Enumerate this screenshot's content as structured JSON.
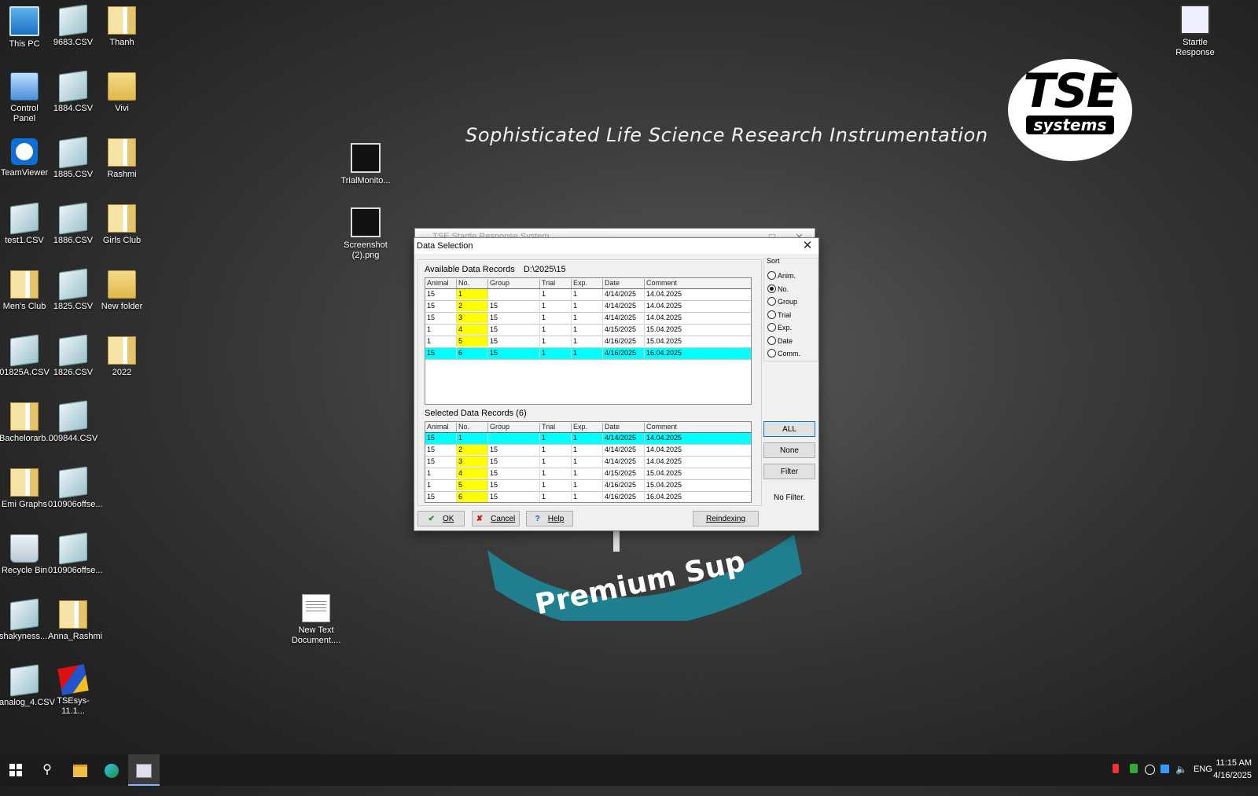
{
  "desktop": {
    "col1": [
      "This PC",
      "Control Panel",
      "TeamViewer",
      "test1.CSV",
      "Men's Club",
      "01825A.CSV",
      "Bachelorarb...",
      "Emi Graphs",
      "Recycle Bin",
      "shakyness....",
      "analog_4.CSV"
    ],
    "col2": [
      "9683.CSV",
      "1884.CSV",
      "1885.CSV",
      "1886.CSV",
      "1825.CSV",
      "1826.CSV",
      "009844.CSV",
      "010906offse...",
      "010906offse...",
      "Anna_Rashmi",
      "TSEsys-11.1..."
    ],
    "col3": [
      "Thanh",
      "Vivi",
      "Rashmi",
      "Girls Club",
      "New folder",
      "2022"
    ],
    "middle": [
      "TrialMonito...",
      "Screenshot (2).png",
      "New Text Document...."
    ],
    "topright": "Startle Response"
  },
  "wallpaper": {
    "slogan": "Sophisticated Life Science Research Instrumentation",
    "logo_big": "TSE",
    "logo_small": "systems",
    "premium": "Premium Sup"
  },
  "bg_window": {
    "title": "TSE Startle Response System"
  },
  "dialog": {
    "title": "Data Selection",
    "available_label": "Available Data Records",
    "available_path": "D:\\2025\\15",
    "selected_label": "Selected Data Records (6)",
    "columns": [
      "Animal",
      "No.",
      "Group",
      "Trial",
      "Exp.",
      "Date",
      "Comment"
    ],
    "available_rows": [
      [
        "15",
        "1",
        "",
        "1",
        "1",
        "4/14/2025",
        "14.04.2025"
      ],
      [
        "15",
        "2",
        "15",
        "1",
        "1",
        "4/14/2025",
        "14.04.2025"
      ],
      [
        "15",
        "3",
        "15",
        "1",
        "1",
        "4/14/2025",
        "14.04.2025"
      ],
      [
        "1",
        "4",
        "15",
        "1",
        "1",
        "4/15/2025",
        "15.04.2025"
      ],
      [
        "1",
        "5",
        "15",
        "1",
        "1",
        "4/16/2025",
        "15.04.2025"
      ],
      [
        "15",
        "6",
        "15",
        "1",
        "1",
        "4/16/2025",
        "16.04.2025"
      ]
    ],
    "selected_rows": [
      [
        "15",
        "1",
        "",
        "1",
        "1",
        "4/14/2025",
        "14.04.2025"
      ],
      [
        "15",
        "2",
        "15",
        "1",
        "1",
        "4/14/2025",
        "14.04.2025"
      ],
      [
        "15",
        "3",
        "15",
        "1",
        "1",
        "4/14/2025",
        "14.04.2025"
      ],
      [
        "1",
        "4",
        "15",
        "1",
        "1",
        "4/15/2025",
        "15.04.2025"
      ],
      [
        "1",
        "5",
        "15",
        "1",
        "1",
        "4/16/2025",
        "15.04.2025"
      ],
      [
        "15",
        "6",
        "15",
        "1",
        "1",
        "4/16/2025",
        "16.04.2025"
      ]
    ],
    "sort": {
      "label": "Sort",
      "options": [
        "Anim.",
        "No.",
        "Group",
        "Trial",
        "Exp.",
        "Date",
        "Comm."
      ],
      "selected": "No."
    },
    "buttons": {
      "all": "ALL",
      "none": "None",
      "filter": "Filter",
      "ok": "OK",
      "cancel": "Cancel",
      "help": "Help",
      "reindex": "Reindexing"
    },
    "filter_status": "No Filter."
  },
  "taskbar": {
    "lang": "ENG",
    "time": "11:15 AM",
    "date": "4/16/2025"
  },
  "colors": {
    "highlight_row": "#00ffff",
    "number_cell": "#ffff00",
    "accent": "#0078d7"
  }
}
